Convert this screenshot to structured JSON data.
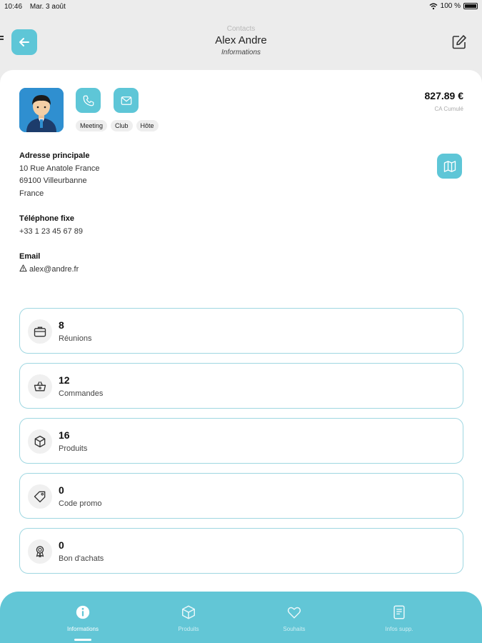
{
  "status_bar": {
    "time": "10:46",
    "date": "Mar. 3 août",
    "battery": "100 %"
  },
  "header": {
    "breadcrumb": "Contacts",
    "title": "Alex Andre",
    "subtitle": "Informations"
  },
  "contact": {
    "tags": [
      "Meeting",
      "Club",
      "Hôte"
    ],
    "amount": "827.89 €",
    "amount_label": "CA Cumulé",
    "address_label": "Adresse principale",
    "address_lines": [
      "10 Rue Anatole France",
      "69100 Villeurbanne",
      "France"
    ],
    "phone_label": "Téléphone fixe",
    "phone": "+33 1 23 45 67 89",
    "email_label": "Email",
    "email": "alex@andre.fr"
  },
  "stats": [
    {
      "value": "8",
      "label": "Réunions",
      "icon": "briefcase-icon"
    },
    {
      "value": "12",
      "label": "Commandes",
      "icon": "basket-icon"
    },
    {
      "value": "16",
      "label": "Produits",
      "icon": "box-icon"
    },
    {
      "value": "0",
      "label": "Code promo",
      "icon": "tag-icon"
    },
    {
      "value": "0",
      "label": "Bon d'achats",
      "icon": "award-icon"
    }
  ],
  "tabs": [
    {
      "label": "Informations",
      "icon": "info-icon",
      "active": true
    },
    {
      "label": "Produits",
      "icon": "box-icon",
      "active": false
    },
    {
      "label": "Souhaits",
      "icon": "heart-icon",
      "active": false
    },
    {
      "label": "Infos supp.",
      "icon": "document-icon",
      "active": false
    }
  ],
  "colors": {
    "accent": "#5ec6d7",
    "tabbar": "#62c6d6",
    "card_border": "#9fd7e1",
    "background": "#ececec"
  }
}
